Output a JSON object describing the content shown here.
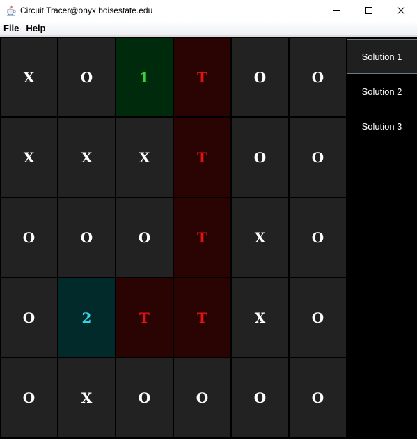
{
  "window": {
    "title": "Circuit Tracer@onyx.boisestate.edu"
  },
  "menu": {
    "file_label": "File",
    "help_label": "Help"
  },
  "colors": {
    "cell_default_bg": "#222222",
    "cell_source_bg": "#002a0c",
    "cell_target_bg": "#2a0303",
    "cell_end_bg": "#032a2b",
    "text_default": "#ffffff",
    "text_source": "#39d23a",
    "text_trace": "#e01414",
    "text_end": "#35d3e3"
  },
  "board": {
    "rows": [
      [
        {
          "v": "X",
          "type": "default"
        },
        {
          "v": "O",
          "type": "default"
        },
        {
          "v": "1",
          "type": "source"
        },
        {
          "v": "T",
          "type": "trace"
        },
        {
          "v": "O",
          "type": "default"
        },
        {
          "v": "O",
          "type": "default"
        }
      ],
      [
        {
          "v": "X",
          "type": "default"
        },
        {
          "v": "X",
          "type": "default"
        },
        {
          "v": "X",
          "type": "default"
        },
        {
          "v": "T",
          "type": "trace"
        },
        {
          "v": "O",
          "type": "default"
        },
        {
          "v": "O",
          "type": "default"
        }
      ],
      [
        {
          "v": "O",
          "type": "default"
        },
        {
          "v": "O",
          "type": "default"
        },
        {
          "v": "O",
          "type": "default"
        },
        {
          "v": "T",
          "type": "trace"
        },
        {
          "v": "X",
          "type": "default"
        },
        {
          "v": "O",
          "type": "default"
        }
      ],
      [
        {
          "v": "O",
          "type": "default"
        },
        {
          "v": "2",
          "type": "end"
        },
        {
          "v": "T",
          "type": "trace"
        },
        {
          "v": "T",
          "type": "trace"
        },
        {
          "v": "X",
          "type": "default"
        },
        {
          "v": "O",
          "type": "default"
        }
      ],
      [
        {
          "v": "O",
          "type": "default"
        },
        {
          "v": "X",
          "type": "default"
        },
        {
          "v": "O",
          "type": "default"
        },
        {
          "v": "O",
          "type": "default"
        },
        {
          "v": "O",
          "type": "default"
        },
        {
          "v": "O",
          "type": "default"
        }
      ]
    ]
  },
  "solutions": {
    "selected_index": 0,
    "items": [
      {
        "label": "Solution 1"
      },
      {
        "label": "Solution 2"
      },
      {
        "label": "Solution 3"
      }
    ]
  }
}
